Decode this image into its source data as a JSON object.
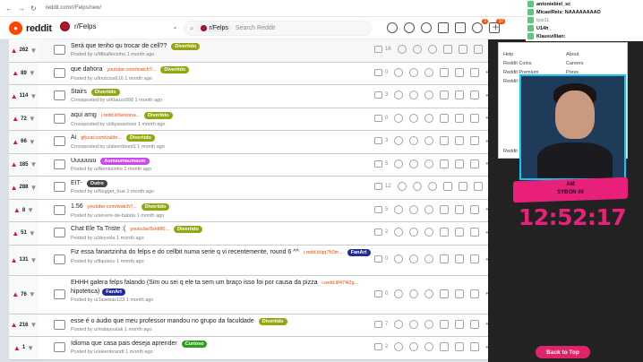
{
  "browser": {
    "url": "reddit.com/r/Felps/new/"
  },
  "header": {
    "brand": "reddit",
    "community": "r/Felps",
    "search_chip": "r/Felps",
    "search_placeholder": "Search Reddit",
    "badge1": "3",
    "badge2": "36"
  },
  "posts": [
    {
      "votes": "262",
      "title": "Será que tenho qu trocar de cell??",
      "link": "",
      "flair": "Divertido",
      "flair_type": "div",
      "meta": "Posted by u/Mikafiecinho 1 month ago",
      "comments": "16",
      "hover": true
    },
    {
      "votes": "89",
      "title": "que dahora",
      "link": "youtube.com/watch?...",
      "flair": "Divertido",
      "flair_type": "div",
      "meta": "Posted by u/Inutcius616 1 month ago",
      "comments": "0"
    },
    {
      "votes": "114",
      "title": "Stairs",
      "link": "",
      "flair": "Divertido",
      "flair_type": "div",
      "meta": "Crossposted by u/Klauzs998 1 month ago",
      "comments": "3"
    },
    {
      "votes": "72",
      "title": "aqui amg",
      "link": "i.redd.it/lvezona...",
      "flair": "Divertido",
      "flair_type": "div",
      "meta": "Crossposted by u/diyasantoss 1 month ago",
      "comments": "0"
    },
    {
      "votes": "66",
      "title": "Ai",
      "link": "gfycat.com/valde...",
      "flair": "Divertido",
      "flair_type": "div",
      "meta": "Crossposted by u/alexnbned1 1 month ago",
      "comments": "3"
    },
    {
      "votes": "185",
      "title": "Uuuuuuu",
      "link": "",
      "flair": "Aumaumaumaum",
      "flair_type": "aum",
      "meta": "Posted by u/Alenkoinho 1 month ago",
      "comments": "5"
    },
    {
      "votes": "288",
      "title": "EIT-",
      "link": "",
      "flair": "Outro",
      "flair_type": "out",
      "meta": "Posted by u/Nugget_true 1 month ago",
      "comments": "12"
    },
    {
      "votes": "8",
      "title": "1.56",
      "link": "youtube.com/watch?...",
      "flair": "Divertido",
      "flair_type": "div",
      "meta": "Posted by u/severe-de-batata 1 month ago",
      "comments": "5"
    },
    {
      "votes": "51",
      "title": "Chat Ele Ta Triste :(",
      "link": "youtu.be/5rktl80...",
      "flair": "Divertido",
      "flair_type": "div",
      "meta": "Posted by u/deyvola 1 month ago",
      "comments": "2"
    },
    {
      "votes": "131",
      "title": "Fiz essa fanartzinha do felps e do cellbit numa serie q vi recentemente, round 6 ^^",
      "link": "i.redd.it/qq7h0m...",
      "flair": "FanArt",
      "flair_type": "fan",
      "meta": "Posted by u/fiquisou 1 month ago",
      "comments": "0",
      "size": "tall"
    },
    {
      "votes": "76",
      "title": "EHHH galera felps falando (Sim ou sei q ele ta sem um braço isso foi por causa da pizza",
      "title2": "hipotetica)",
      "link": "i.redd.it/474i2g...",
      "flair": "FanArt",
      "flair_type": "fan",
      "meta": "Posted by u/Jasebas123 1 month ago",
      "comments": "0",
      "size": "vtall"
    },
    {
      "votes": "216",
      "title": "esse é o áudio que meu professor mandou no grupo da faculdade",
      "link": "",
      "flair": "Divertido",
      "flair_type": "div",
      "meta": "Posted by u/malayostak 1 month ago",
      "comments": "7"
    },
    {
      "votes": "1",
      "title": "Idioma que casa pais deseja aprender",
      "link": "",
      "flair": "Curioso",
      "flair_type": "cur",
      "meta": "Posted by u/aleenbrandt 1 month ago",
      "comments": "2"
    }
  ],
  "overlay": {
    "chat": [
      "antoniebiel_sc",
      "MicaelReis: NAAAAAAAAO",
      "tpis11",
      "U14h_",
      "Klausvillian:"
    ],
    "menu": [
      "Help",
      "Reddit Coins",
      "Reddit Premium",
      "Reddit Gifts",
      "About",
      "Careers",
      "Press",
      "Reddit"
    ],
    "caption_line1": "AM",
    "caption_line2": "SYBON 40",
    "clock": "12:52:17"
  },
  "back_to_top": "Back to Top",
  "colors": {
    "upvote": "#e0122b",
    "flair_divertido": "#94a610",
    "accent": "#e8207a",
    "cam_border": "#15c5f2"
  }
}
